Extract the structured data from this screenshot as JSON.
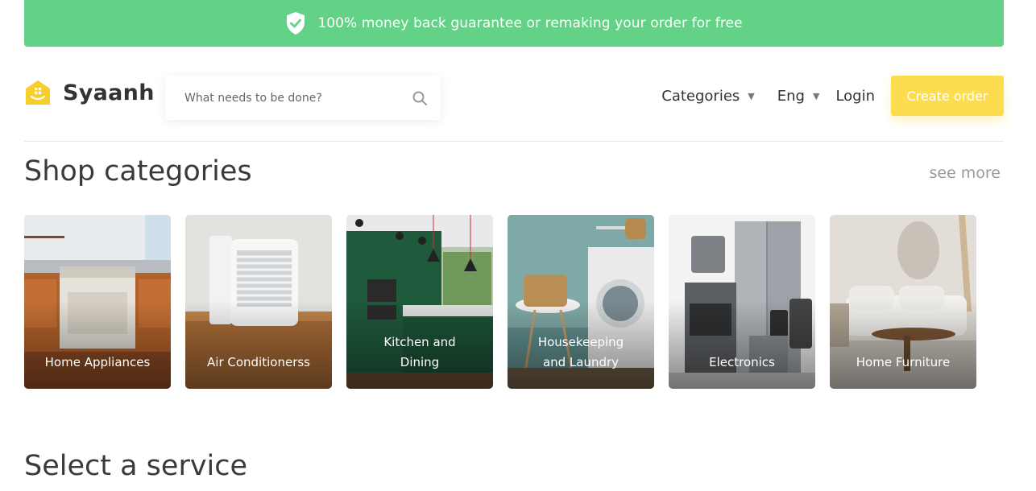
{
  "banner": {
    "text": "100% money back guarantee or remaking your order for free",
    "icon": "shield-check-icon"
  },
  "header": {
    "brand": "Syaanh",
    "search_placeholder": "What needs to be done?",
    "nav": {
      "categories": "Categories",
      "language": "Eng",
      "login": "Login",
      "create_order": "Create order"
    }
  },
  "shop_categories": {
    "title": "Shop categories",
    "see_more": "see more",
    "items": [
      {
        "label": "Home Appliances"
      },
      {
        "label": "Air Conditionerss"
      },
      {
        "label": "Kitchen and\nDining"
      },
      {
        "label": "Housekeeping\nand Laundry"
      },
      {
        "label": "Electronics"
      },
      {
        "label": "Home Furniture"
      }
    ]
  },
  "select_service": {
    "title": "Select a service"
  },
  "colors": {
    "banner": "#63d286",
    "accent": "#fddc4f"
  }
}
